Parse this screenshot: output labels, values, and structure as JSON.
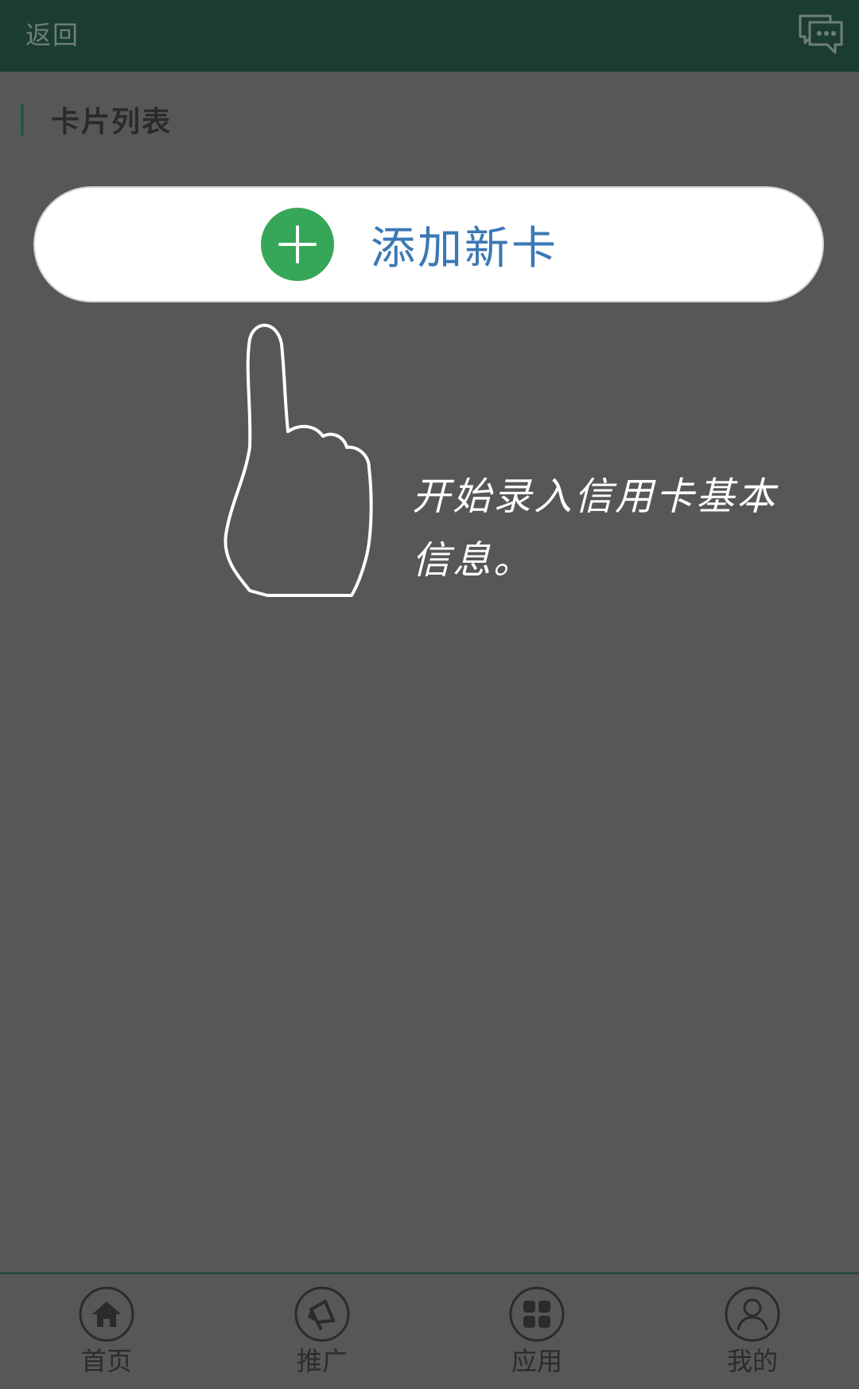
{
  "header": {
    "back_label": "返回",
    "chat_icon": "chat-bubble-icon"
  },
  "section": {
    "title": "卡片列表"
  },
  "add_card": {
    "label": "添加新卡",
    "icon": "plus-circle-icon",
    "icon_color": "#36a758",
    "text_color": "#3b78b5"
  },
  "hint": {
    "line1": "开始录入信用卡基本",
    "line2": "信息。",
    "icon": "pointing-hand-icon"
  },
  "tabbar": {
    "items": [
      {
        "label": "首页",
        "icon": "home-icon"
      },
      {
        "label": "推广",
        "icon": "megaphone-icon"
      },
      {
        "label": "应用",
        "icon": "apps-grid-icon"
      },
      {
        "label": "我的",
        "icon": "user-icon"
      }
    ]
  },
  "colors": {
    "header_bg": "#1b3d2f",
    "overlay_bg": "#575757",
    "accent_green": "#36a758"
  }
}
